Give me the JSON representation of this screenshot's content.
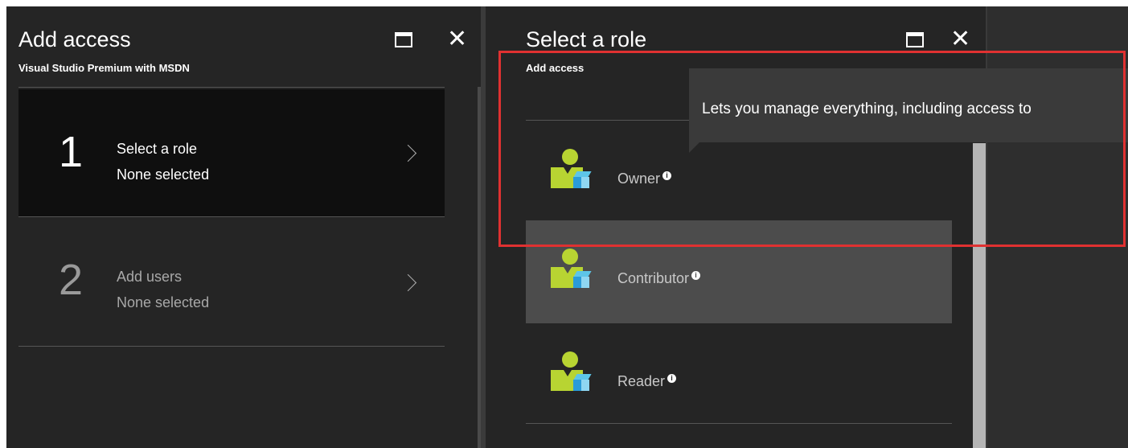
{
  "blade_add_access": {
    "title": "Add access",
    "subtitle": "Visual Studio Premium with MSDN",
    "steps": [
      {
        "number": "1",
        "title": "Select a role",
        "status": "None selected"
      },
      {
        "number": "2",
        "title": "Add users",
        "status": "None selected"
      }
    ]
  },
  "blade_select_role": {
    "title": "Select a role",
    "subtitle": "Add access",
    "roles": [
      {
        "label": "Owner"
      },
      {
        "label": "Contributor"
      },
      {
        "label": "Reader"
      }
    ]
  },
  "tooltip": {
    "text": "Lets you manage everything, including access to"
  },
  "icons": {
    "maximize": "maximize-icon",
    "close": "close-icon",
    "chevron": "chevron-right-icon",
    "info": "info-icon",
    "role": "user-role-icon"
  },
  "colors": {
    "highlight": "#e03131",
    "avatar_green": "#b8d432",
    "cube_blue": "#2a9bd8"
  }
}
